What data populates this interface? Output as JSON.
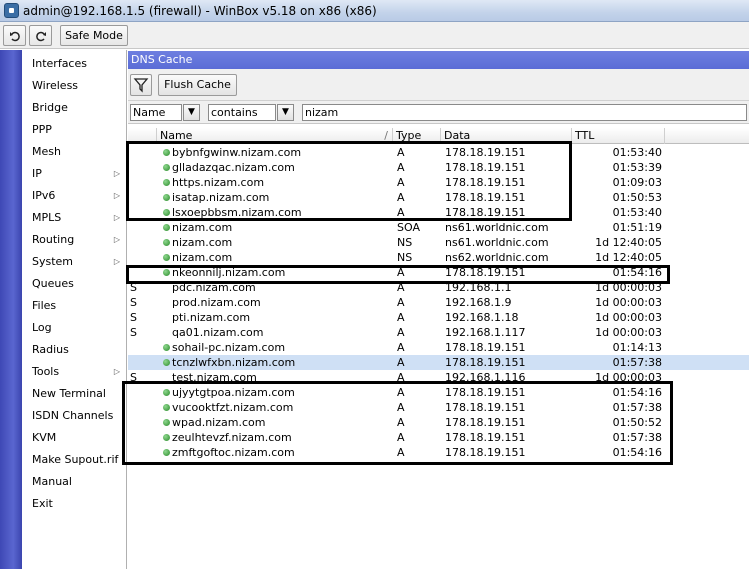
{
  "window": {
    "title": "admin@192.168.1.5 (firewall) - WinBox v5.18 on x86 (x86)"
  },
  "toolbar": {
    "undo_icon": "undo-icon",
    "redo_icon": "redo-icon",
    "safe_mode_label": "Safe Mode"
  },
  "sidebar": {
    "items": [
      {
        "label": "Interfaces",
        "submenu": false
      },
      {
        "label": "Wireless",
        "submenu": false
      },
      {
        "label": "Bridge",
        "submenu": false
      },
      {
        "label": "PPP",
        "submenu": false
      },
      {
        "label": "Mesh",
        "submenu": false
      },
      {
        "label": "IP",
        "submenu": true
      },
      {
        "label": "IPv6",
        "submenu": true
      },
      {
        "label": "MPLS",
        "submenu": true
      },
      {
        "label": "Routing",
        "submenu": true
      },
      {
        "label": "System",
        "submenu": true
      },
      {
        "label": "Queues",
        "submenu": false
      },
      {
        "label": "Files",
        "submenu": false
      },
      {
        "label": "Log",
        "submenu": false
      },
      {
        "label": "Radius",
        "submenu": false
      },
      {
        "label": "Tools",
        "submenu": true
      },
      {
        "label": "New Terminal",
        "submenu": false
      },
      {
        "label": "ISDN Channels",
        "submenu": false
      },
      {
        "label": "KVM",
        "submenu": false
      },
      {
        "label": "Make Supout.rif",
        "submenu": false
      },
      {
        "label": "Manual",
        "submenu": false
      },
      {
        "label": "Exit",
        "submenu": false
      }
    ]
  },
  "dns_cache": {
    "title": "DNS Cache",
    "flush_label": "Flush Cache",
    "filter": {
      "field": "Name",
      "operator": "contains",
      "value": "nizam"
    },
    "columns": [
      "Name",
      "Type",
      "Data",
      "TTL"
    ],
    "rows": [
      {
        "flag": "",
        "name": "bybnfgwinw.nizam.com",
        "type": "A",
        "data": "178.18.19.151",
        "ttl": "01:53:40"
      },
      {
        "flag": "",
        "name": "glladazqac.nizam.com",
        "type": "A",
        "data": "178.18.19.151",
        "ttl": "01:53:39"
      },
      {
        "flag": "",
        "name": "https.nizam.com",
        "type": "A",
        "data": "178.18.19.151",
        "ttl": "01:09:03"
      },
      {
        "flag": "",
        "name": "isatap.nizam.com",
        "type": "A",
        "data": "178.18.19.151",
        "ttl": "01:50:53"
      },
      {
        "flag": "",
        "name": "lsxoepbbsm.nizam.com",
        "type": "A",
        "data": "178.18.19.151",
        "ttl": "01:53:40"
      },
      {
        "flag": "",
        "name": "nizam.com",
        "type": "SOA",
        "data": "ns61.worldnic.com",
        "ttl": "01:51:19"
      },
      {
        "flag": "",
        "name": "nizam.com",
        "type": "NS",
        "data": "ns61.worldnic.com",
        "ttl": "1d 12:40:05"
      },
      {
        "flag": "",
        "name": "nizam.com",
        "type": "NS",
        "data": "ns62.worldnic.com",
        "ttl": "1d 12:40:05"
      },
      {
        "flag": "",
        "name": "nkeonnilj.nizam.com",
        "type": "A",
        "data": "178.18.19.151",
        "ttl": "01:54:16"
      },
      {
        "flag": "S",
        "name": "pdc.nizam.com",
        "type": "A",
        "data": "192.168.1.1",
        "ttl": "1d 00:00:03"
      },
      {
        "flag": "S",
        "name": "prod.nizam.com",
        "type": "A",
        "data": "192.168.1.9",
        "ttl": "1d 00:00:03"
      },
      {
        "flag": "S",
        "name": "pti.nizam.com",
        "type": "A",
        "data": "192.168.1.18",
        "ttl": "1d 00:00:03"
      },
      {
        "flag": "S",
        "name": "qa01.nizam.com",
        "type": "A",
        "data": "192.168.1.117",
        "ttl": "1d 00:00:03"
      },
      {
        "flag": "",
        "name": "sohail-pc.nizam.com",
        "type": "A",
        "data": "178.18.19.151",
        "ttl": "01:14:13"
      },
      {
        "flag": "",
        "name": "tcnzlwfxbn.nizam.com",
        "type": "A",
        "data": "178.18.19.151",
        "ttl": "01:57:38",
        "selected": true
      },
      {
        "flag": "S",
        "name": "test.nizam.com",
        "type": "A",
        "data": "192.168.1.116",
        "ttl": "1d 00:00:03"
      },
      {
        "flag": "",
        "name": "ujyytgtpoa.nizam.com",
        "type": "A",
        "data": "178.18.19.151",
        "ttl": "01:54:16"
      },
      {
        "flag": "",
        "name": "vucooktfzt.nizam.com",
        "type": "A",
        "data": "178.18.19.151",
        "ttl": "01:57:38"
      },
      {
        "flag": "",
        "name": "wpad.nizam.com",
        "type": "A",
        "data": "178.18.19.151",
        "ttl": "01:50:52"
      },
      {
        "flag": "",
        "name": "zeulhtevzf.nizam.com",
        "type": "A",
        "data": "178.18.19.151",
        "ttl": "01:57:38"
      },
      {
        "flag": "",
        "name": "zmftgoftoc.nizam.com",
        "type": "A",
        "data": "178.18.19.151",
        "ttl": "01:54:16"
      }
    ]
  },
  "colors": {
    "sidebar_strip": "#4a55c2",
    "window_title": "#6272dc",
    "selected_row": "#cfe0f5",
    "status_dot": "#2a8a2a"
  }
}
